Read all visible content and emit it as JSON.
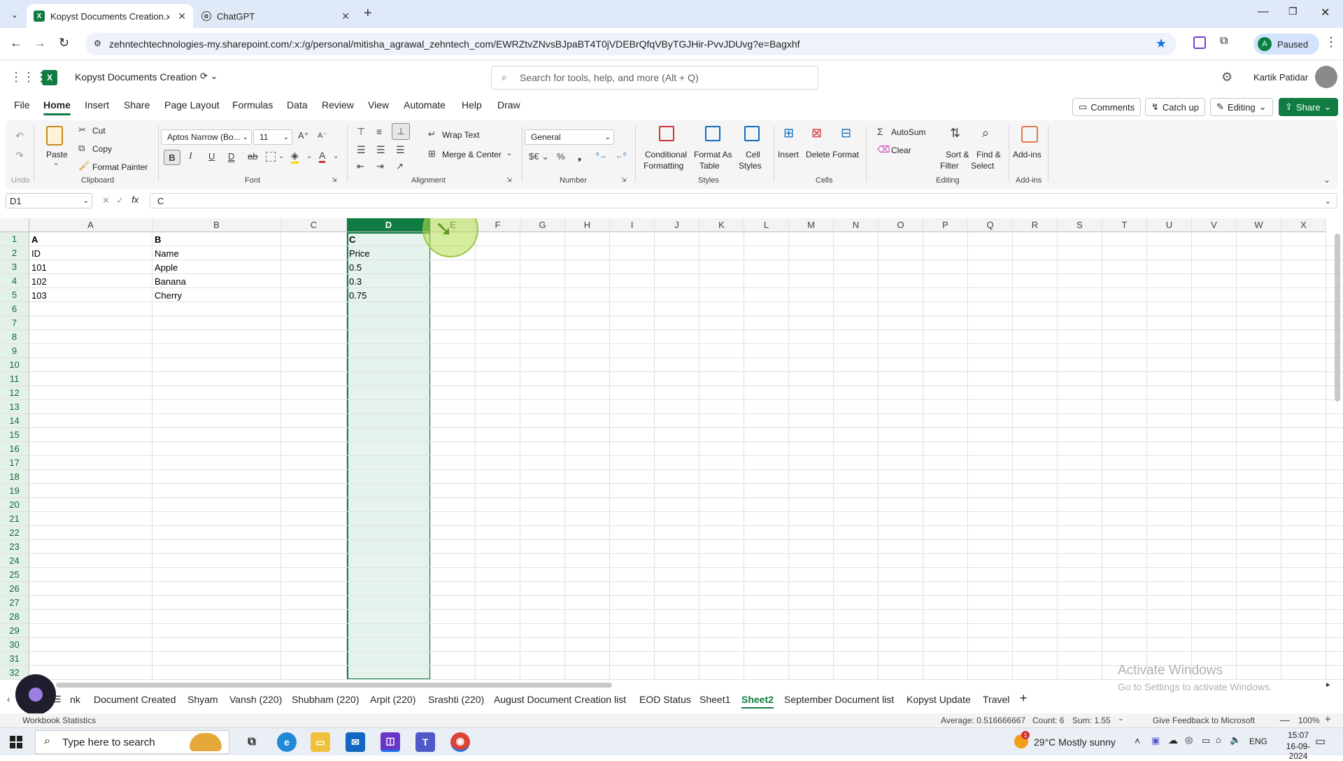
{
  "browser": {
    "tabs": [
      {
        "title": "Kopyst Documents Creation.xls",
        "active": true
      },
      {
        "title": "ChatGPT",
        "active": false
      }
    ],
    "url": "zehntechtechnologies-my.sharepoint.com/:x:/g/personal/mitisha_agrawal_zehntech_com/EWRZtvZNvsBJpaBT4T0jVDEBrQfqVByTGJHir-PvvJDUvg?e=Bagxhf",
    "profile_label": "Paused",
    "profile_initial": "A"
  },
  "app": {
    "title": "Kopyst Documents Creation",
    "search_placeholder": "Search for tools, help, and more (Alt + Q)",
    "user_name": "Kartik Patidar"
  },
  "menu": {
    "items": [
      "File",
      "Home",
      "Insert",
      "Share",
      "Page Layout",
      "Formulas",
      "Data",
      "Review",
      "View",
      "Automate",
      "Help",
      "Draw"
    ],
    "comments": "Comments",
    "catch_up": "Catch up",
    "editing": "Editing",
    "share": "Share"
  },
  "ribbon": {
    "undo_label": "Undo",
    "paste": "Paste",
    "cut": "Cut",
    "copy": "Copy",
    "format_painter": "Format Painter",
    "clipboard": "Clipboard",
    "font_name": "Aptos Narrow (Bo...",
    "font_size": "11",
    "font": "Font",
    "wrap_text": "Wrap Text",
    "merge_center": "Merge & Center",
    "alignment": "Alignment",
    "number_format": "General",
    "number": "Number",
    "conditional_formatting_1": "Conditional",
    "conditional_formatting_2": "Formatting",
    "format_as_table_1": "Format As",
    "format_as_table_2": "Table",
    "cell_styles_1": "Cell",
    "cell_styles_2": "Styles",
    "styles": "Styles",
    "insert": "Insert",
    "delete": "Delete",
    "format": "Format",
    "cells": "Cells",
    "autosum": "AutoSum",
    "clear": "Clear",
    "sort_filter_1": "Sort &",
    "sort_filter_2": "Filter",
    "find_select_1": "Find &",
    "find_select_2": "Select",
    "editing": "Editing",
    "addins": "Add-ins",
    "addins_group": "Add-ins"
  },
  "formula_bar": {
    "name_box": "D1",
    "content": "C"
  },
  "grid": {
    "columns": [
      "A",
      "B",
      "C",
      "D",
      "E",
      "F",
      "G",
      "H",
      "I",
      "J",
      "K",
      "L",
      "M",
      "N",
      "O",
      "P",
      "Q",
      "R",
      "S",
      "T",
      "U",
      "V",
      "W",
      "X"
    ],
    "rows": [
      "1",
      "2",
      "3",
      "4",
      "5",
      "6",
      "7",
      "8",
      "9",
      "10",
      "11",
      "12",
      "13",
      "14",
      "15",
      "16",
      "17",
      "18",
      "19",
      "20",
      "21",
      "22",
      "23",
      "24",
      "25",
      "26",
      "27",
      "28",
      "29",
      "30",
      "31",
      "32"
    ],
    "cells": {
      "A1": "A",
      "B1": "B",
      "D1": "C",
      "A2": "ID",
      "B2": "Name",
      "D2": "Price",
      "A3": "101",
      "B3": "Apple",
      "D3": "0.5",
      "A4": "102",
      "B4": "Banana",
      "D4": "0.3",
      "A5": "103",
      "B5": "Cherry",
      "D5": "0.75"
    }
  },
  "sheets": {
    "tabs": [
      "nk",
      "Document Created",
      "Shyam",
      "Vansh (220)",
      "Shubham (220)",
      "Arpit (220)",
      "Srashti (220)",
      "August Document Creation list",
      "EOD Status",
      "Sheet1",
      "Sheet2",
      "September Document list",
      "Kopyst Update",
      "Travel"
    ],
    "active": "Sheet2"
  },
  "watermark": {
    "line1": "Activate Windows",
    "line2": "Go to Settings to activate Windows."
  },
  "status": {
    "left": "Workbook Statistics",
    "average": "Average: 0.516666667",
    "count": "Count: 6",
    "sum": "Sum: 1.55",
    "feedback": "Give Feedback to Microsoft",
    "zoom": "100%"
  },
  "taskbar": {
    "search_placeholder": "Type here to search",
    "weather": "29°C  Mostly sunny",
    "lang": "ENG",
    "time": "15:07",
    "date": "16-09-2024"
  },
  "colors": {
    "excel_green": "#107c41",
    "selection_fill": "#e6f3ec"
  }
}
